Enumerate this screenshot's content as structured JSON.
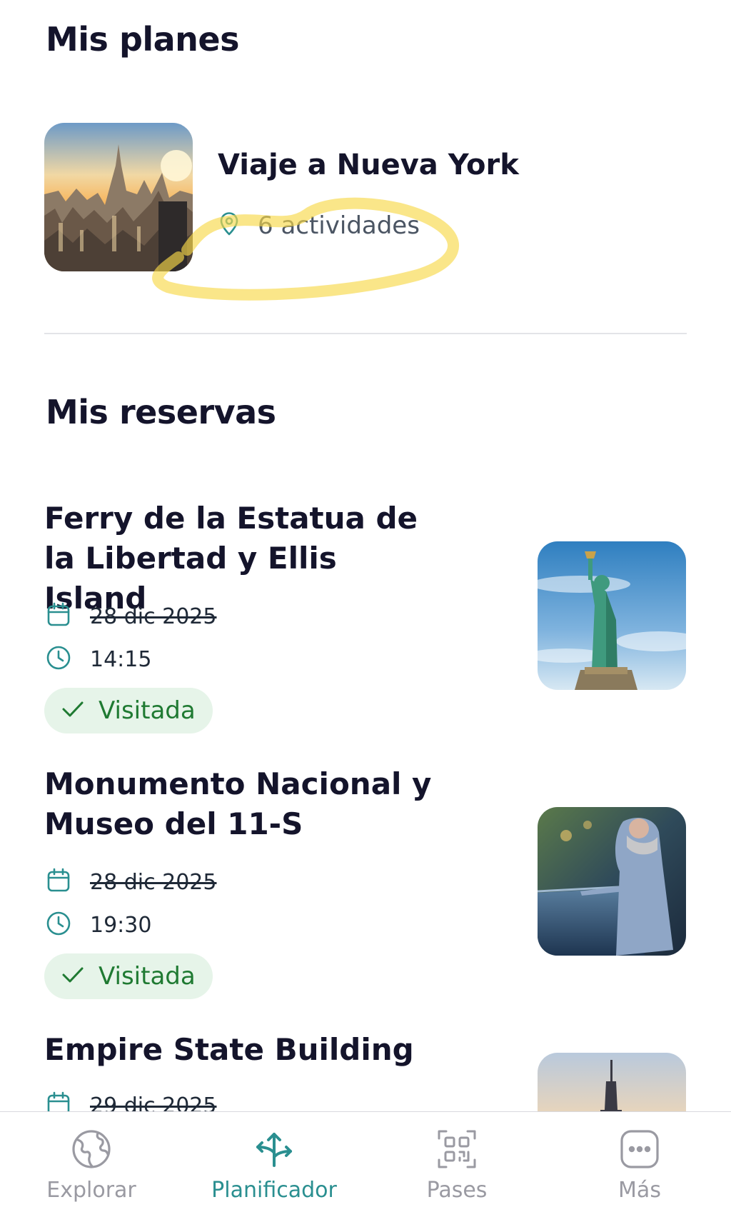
{
  "plans": {
    "section_title": "Mis planes",
    "card": {
      "title": "Viaje a Nueva York",
      "activities": "6 actividades"
    }
  },
  "reservations": {
    "section_title": "Mis reservas",
    "items": [
      {
        "title": "Ferry de la Estatua de la Libertad y Ellis Island",
        "date": "28 dic 2025",
        "time": "14:15",
        "status": "Visitada"
      },
      {
        "title": "Monumento Nacional y Museo del 11-S",
        "date": "28 dic 2025",
        "time": "19:30",
        "status": "Visitada"
      },
      {
        "title": "Empire State Building",
        "date": "29 dic 2025"
      }
    ]
  },
  "bottom_nav": {
    "items": [
      {
        "label": "Explorar",
        "icon": "globe-icon"
      },
      {
        "label": "Planificador",
        "icon": "route-arrows-icon",
        "active": true
      },
      {
        "label": "Pases",
        "icon": "qr-code-icon"
      },
      {
        "label": "Más",
        "icon": "more-dots-icon"
      }
    ]
  },
  "colors": {
    "accent": "#2a8f90",
    "status_green": "#1f7a32",
    "status_bg": "#e6f4e9",
    "highlight": "#f7d84a"
  }
}
